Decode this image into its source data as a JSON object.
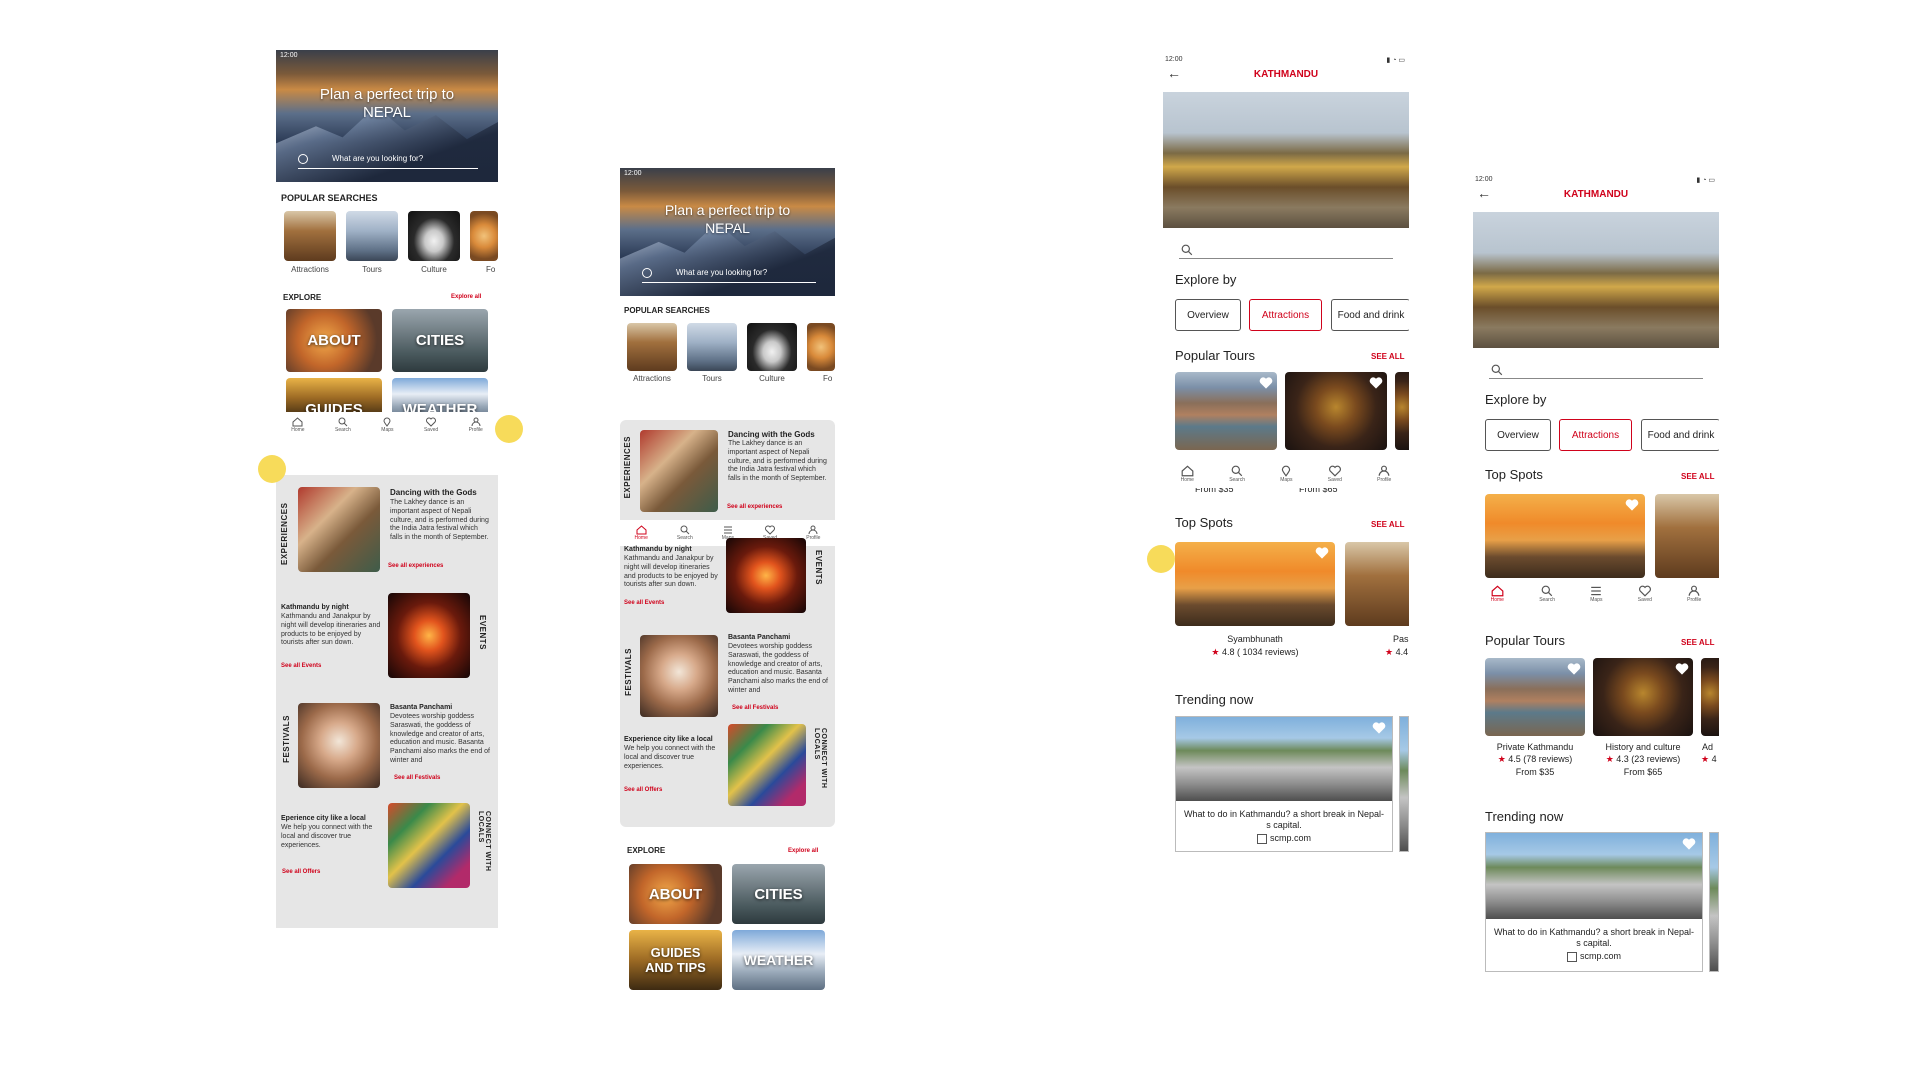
{
  "colors": {
    "accent": "#d0021b",
    "panel": "#e6e6e6",
    "highlight_dot": "#f7db5a"
  },
  "screen1": {
    "status_time": "12:00",
    "hero_title_line1": "Plan a perfect trip to",
    "hero_title_line2": "NEPAL",
    "search_placeholder": "What are you looking for?",
    "popular_searches_title": "POPULAR SEARCHES",
    "popular": [
      "Attractions",
      "Tours",
      "Culture",
      "Fo"
    ],
    "explore_title": "EXPLORE",
    "explore_all": "Explore all",
    "tiles": [
      "ABOUT",
      "CITIES",
      "GUIDES",
      "WEATHER"
    ],
    "nav": [
      "Home",
      "Search",
      "Maps",
      "Saved",
      "Profile"
    ],
    "exp_label": "EXPERIENCES",
    "exp_title": "Dancing with the Gods",
    "exp_text": "The Lakhey dance is an important aspect of Nepali culture, and is performed during the India Jatra festival which falls in the month of September.",
    "exp_link": "See all experiences",
    "events_label": "EVENTS",
    "events_title": "Kathmandu by night",
    "events_text": "Kathmandu and Janakpur by night will develop itineraries and products to be enjoyed by tourists after sun down.",
    "events_link": "See all Events",
    "fest_label": "FESTIVALS",
    "fest_title": "Basanta Panchami",
    "fest_text": "Devotees worship goddess Saraswati, the goddess of knowledge and creator of arts, education and music. Basanta Panchami also marks the end of winter and",
    "fest_link": "See all Festivals",
    "locals_label": "CONNECT WITH LOCALS",
    "locals_title": "Eperience city like a local",
    "locals_text": "We help you connect with the local and discover true experiences.",
    "locals_link": "See all Offers"
  },
  "screen2": {
    "status_time": "12:00",
    "hero_title_line1": "Plan a perfect trip to",
    "hero_title_line2": "NEPAL",
    "search_placeholder": "What are you looking for?",
    "popular_searches_title": "POPULAR SEARCHES",
    "popular": [
      "Attractions",
      "Tours",
      "Culture",
      "Fo"
    ],
    "exp_label": "EXPERIENCES",
    "exp_title": "Dancing with the Gods",
    "exp_text": "The Lakhey dance is an important aspect of Nepali culture, and is performed during the India Jatra festival which falls in the month of September.",
    "exp_link": "See all experiences",
    "nav": [
      "Home",
      "Search",
      "Maps",
      "Saved",
      "Profile"
    ],
    "events_label": "EVENTS",
    "events_title": "Kathmandu by night",
    "events_text": "Kathmandu and Janakpur by night will develop itineraries and products to be enjoyed by tourists after sun down.",
    "events_link": "See all Events",
    "fest_label": "FESTIVALS",
    "fest_title": "Basanta Panchami",
    "fest_text": "Devotees worship goddess Saraswati, the goddess of knowledge and creator of arts, education and music. Basanta Panchami also marks the end of winter and",
    "fest_link": "See all Festivals",
    "locals_label": "CONNECT WITH LOCALS",
    "locals_title": "Experience city like a local",
    "locals_text": "We help you connect with the local and discover true experiences.",
    "locals_link": "See all Offers",
    "explore_title": "EXPLORE",
    "explore_all": "Explore all",
    "tiles": [
      "ABOUT",
      "CITIES",
      "GUIDES AND TIPS",
      "WEATHER"
    ]
  },
  "screen3": {
    "status_time": "12:00",
    "city_title": "KATHMANDU",
    "explore_by": "Explore by",
    "chips": [
      "Overview",
      "Attractions",
      "Food and drink"
    ],
    "popular_tours": "Popular Tours",
    "see_all": "SEE ALL",
    "tour_prices": [
      "From $35",
      "From $65"
    ],
    "nav": [
      "Home",
      "Search",
      "Maps",
      "Saved",
      "Profile"
    ],
    "top_spots": "Top Spots",
    "spot_name": "Syambhunath",
    "spot_rating": "4.8 ( 1034 reviews)",
    "spot2_name": "Pas",
    "spot2_rating": "4.4",
    "trending": "Trending now",
    "trend_text": "What to do in Kathmandu? a short break in Nepal-s capital.",
    "trend_source": "scmp.com"
  },
  "screen4": {
    "status_time": "12:00",
    "city_title": "KATHMANDU",
    "explore_by": "Explore by",
    "chips": [
      "Overview",
      "Attractions",
      "Food and drink"
    ],
    "top_spots": "Top Spots",
    "see_all": "SEE ALL",
    "nav": [
      "Home",
      "Search",
      "Maps",
      "Saved",
      "Profile"
    ],
    "popular_tours": "Popular Tours",
    "tours": [
      {
        "name": "Private Kathmandu",
        "rating": "4.5 (78 reviews)",
        "price": "From $35"
      },
      {
        "name": "History and culture",
        "rating": "4.3 (23 reviews)",
        "price": "From $65"
      },
      {
        "name": "Ad",
        "rating": "4",
        "price": ""
      }
    ],
    "trending": "Trending now",
    "trend_text": "What to do in Kathmandu? a short break in Nepal-s capital.",
    "trend_source": "scmp.com"
  }
}
